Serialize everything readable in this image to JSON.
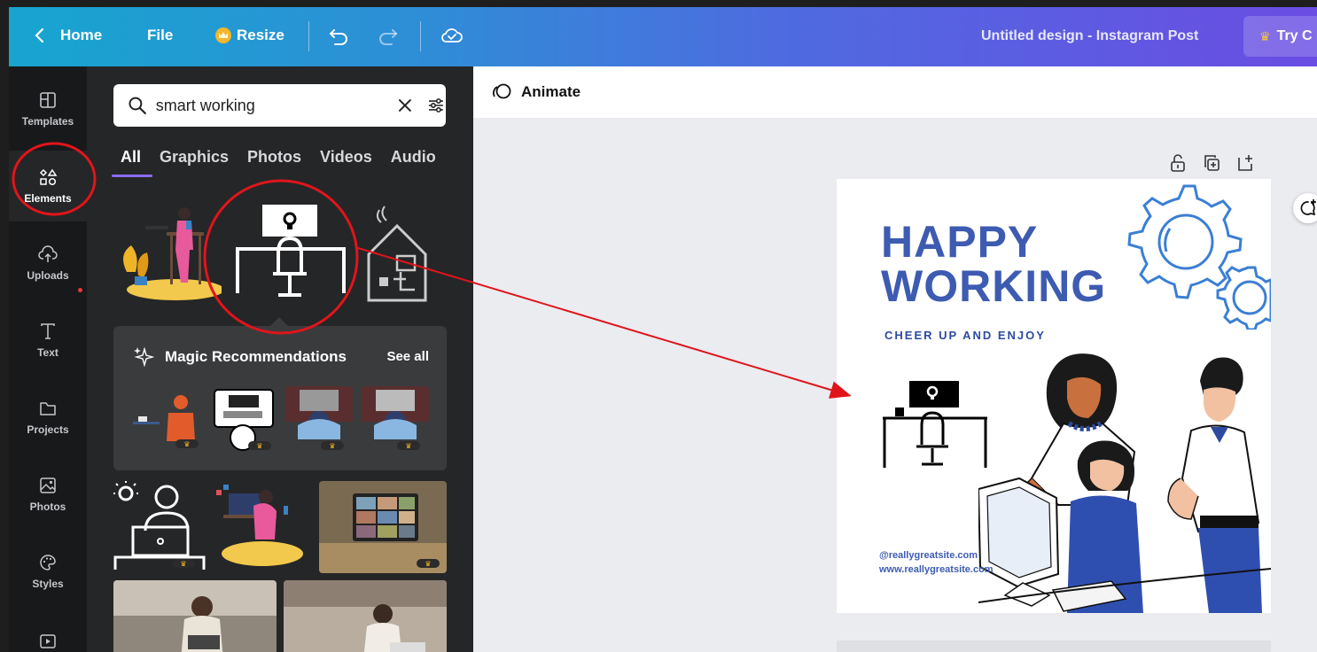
{
  "topbar": {
    "home": "Home",
    "file": "File",
    "resize": "Resize",
    "design_title": "Untitled design - Instagram Post",
    "try_label": "Try C"
  },
  "rail": [
    {
      "label": "Templates",
      "icon": "templates-icon"
    },
    {
      "label": "Elements",
      "icon": "elements-icon"
    },
    {
      "label": "Uploads",
      "icon": "uploads-icon"
    },
    {
      "label": "Text",
      "icon": "text-icon"
    },
    {
      "label": "Projects",
      "icon": "folder-icon"
    },
    {
      "label": "Photos",
      "icon": "photos-icon"
    },
    {
      "label": "Styles",
      "icon": "palette-icon"
    },
    {
      "label": "",
      "icon": "videos-icon"
    }
  ],
  "panel": {
    "search_value": "smart working",
    "tabs": [
      "All",
      "Graphics",
      "Photos",
      "Videos",
      "Audio"
    ],
    "magic_title": "Magic Recommendations",
    "see_all": "See all"
  },
  "editor": {
    "animate": "Animate"
  },
  "canvas": {
    "line1": "HAPPY",
    "line2": "WORKING",
    "subtitle": "CHEER UP AND ENJOY",
    "handle": "@reallygreatsite.com",
    "website": "www.reallygreatsite.com"
  },
  "colors": {
    "accent_red": "#e0151b",
    "brand_blue": "#3d5bb1",
    "panel_bg": "#252627"
  }
}
